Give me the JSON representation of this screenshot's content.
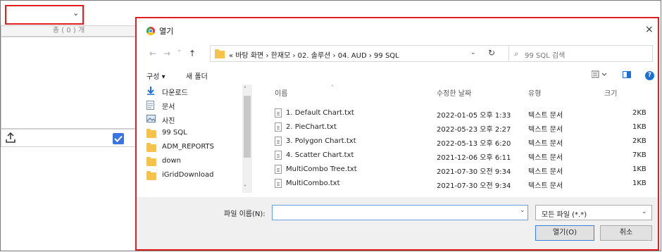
{
  "left_panel": {
    "select_chevron": "⌄",
    "count_header": "총 ( 0 ) 개"
  },
  "dialog": {
    "title": "열기",
    "close": "×",
    "nav": {
      "back": "←",
      "forward": "→",
      "recent": "⌄",
      "up": "↑"
    },
    "address": {
      "prefix": "«",
      "crumbs": [
        "바탕 화면",
        "한재모",
        "02. 솔루션",
        "04. AUD",
        "99 SQL"
      ],
      "separator": "›",
      "dropdown": "⌄",
      "refresh": "↻"
    },
    "search": {
      "placeholder": "99 SQL 검색",
      "icon": "⌕"
    },
    "toolbar": {
      "organize": "구성 ▾",
      "new_folder": "새 폴더"
    },
    "nav_pane": [
      {
        "label": "다운로드",
        "icon": "download-icon",
        "pinned": true
      },
      {
        "label": "문서",
        "icon": "document-icon",
        "pinned": true
      },
      {
        "label": "사진",
        "icon": "picture-icon",
        "pinned": true
      },
      {
        "label": "99 SQL",
        "icon": "folder-icon",
        "pinned": false
      },
      {
        "label": "ADM_REPORTS",
        "icon": "folder-icon",
        "pinned": false
      },
      {
        "label": "down",
        "icon": "folder-icon",
        "pinned": false
      },
      {
        "label": "iGridDownload",
        "icon": "folder-icon",
        "pinned": false
      }
    ],
    "columns": {
      "name": "이름",
      "modified": "수정한 날짜",
      "type": "유형",
      "size": "크기"
    },
    "files": [
      {
        "name": "1. Default Chart.txt",
        "modified": "2022-01-05 오후 1:33",
        "type": "텍스트 문서",
        "size": "2KB"
      },
      {
        "name": "2. PieChart.txt",
        "modified": "2022-05-23 오후 2:27",
        "type": "텍스트 문서",
        "size": "1KB"
      },
      {
        "name": "3. Polygon Chart.txt",
        "modified": "2022-05-13 오후 6:20",
        "type": "텍스트 문서",
        "size": "2KB"
      },
      {
        "name": "4. Scatter Chart.txt",
        "modified": "2021-12-06 오후 6:11",
        "type": "텍스트 문서",
        "size": "7KB"
      },
      {
        "name": "MultiCombo Tree.txt",
        "modified": "2021-07-30 오전 9:34",
        "type": "텍스트 문서",
        "size": "1KB"
      },
      {
        "name": "MultiCombo.txt",
        "modified": "2021-07-30 오전 9:34",
        "type": "텍스트 문서",
        "size": "1KB"
      }
    ],
    "filename_label": "파일 이름(N):",
    "filename_value": "",
    "filter_value": "모든 파일 (*.*)",
    "open_button": "열기(O)",
    "cancel_button": "취소",
    "colors": {
      "highlight_border": "#e02020",
      "accent": "#1a6fd8",
      "folder": "#f6c34a"
    }
  }
}
